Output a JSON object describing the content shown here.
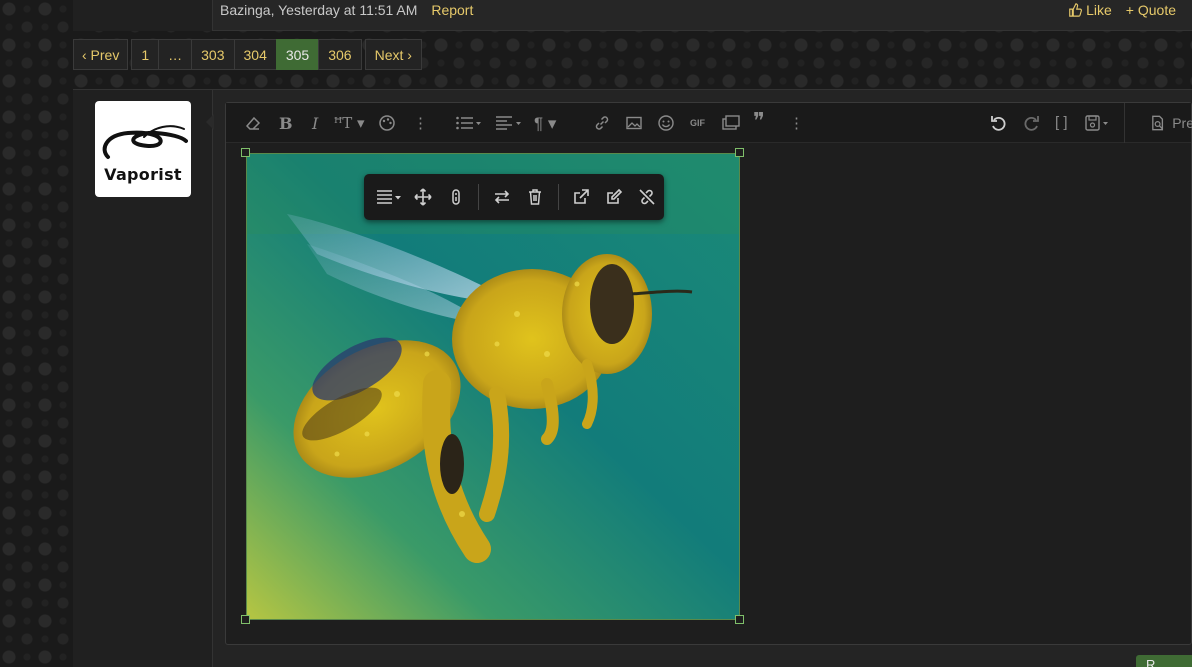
{
  "post_meta": {
    "author_time": "Bazinga, Yesterday at 11:51 AM",
    "report_label": "Report",
    "like_label": "Like",
    "quote_label": "+ Quote"
  },
  "pager": {
    "prev_label": "‹ Prev",
    "pages": [
      "1",
      "…",
      "303",
      "304",
      "305",
      "306"
    ],
    "current_page": "305",
    "next_label": "Next ›"
  },
  "avatar": {
    "brand_text": "Vaporist"
  },
  "editor": {
    "toolbar_icons": [
      "eraser-icon",
      "bold-icon",
      "italic-icon",
      "text-size-icon",
      "palette-icon",
      "more-icon",
      "list-icon",
      "align-icon",
      "paragraph-icon",
      "link-icon",
      "image-icon",
      "smilie-icon",
      "gif-icon",
      "media-icon",
      "quote-icon",
      "more-icon",
      "undo-icon",
      "redo-icon",
      "bbcode-icon",
      "drafts-icon"
    ],
    "gif_label": "GIF",
    "preview_label": "Pre",
    "image_alt": "Pollen-covered honey bee"
  },
  "image_toolbar": {
    "icons": [
      "align-icon",
      "move-icon",
      "alt-text-icon",
      "replace-icon",
      "delete-icon",
      "open-link-icon",
      "edit-link-icon",
      "unlink-icon"
    ]
  },
  "submit": {
    "label": "R"
  },
  "colors": {
    "accent_link": "#e6c96a",
    "active_page": "#3f6b34",
    "handle_border": "#7fbf6a"
  }
}
